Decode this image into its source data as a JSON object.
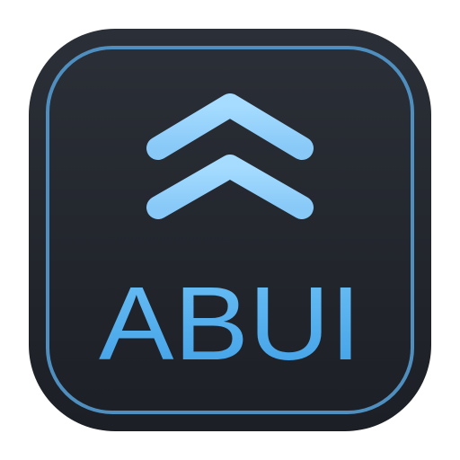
{
  "app_icon": {
    "name": "ABUI",
    "glyph": "double-chevron-up-icon",
    "colors": {
      "tile_top": "#2b2f37",
      "tile_bottom": "#1c1f25",
      "border_stroke": "#4f8fbf",
      "chevron_top": "#9fd8ff",
      "chevron_bottom": "#8fd0ff",
      "text_top": "#6cc0f5",
      "text_bottom": "#3f9fe6"
    }
  }
}
